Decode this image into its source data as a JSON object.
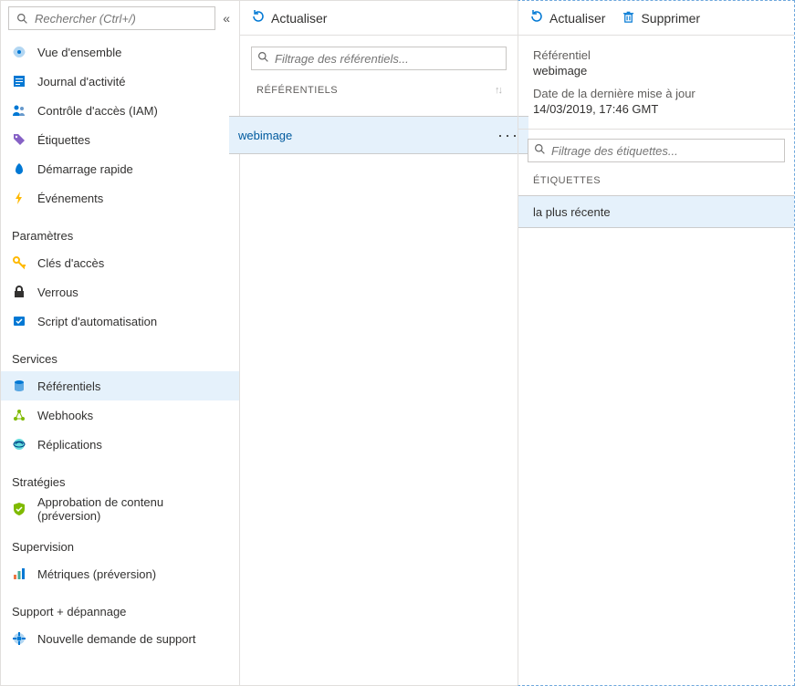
{
  "sidebar": {
    "search_placeholder": "Rechercher (Ctrl+/)",
    "items_top": [
      {
        "label": "Vue d'ensemble",
        "icon": "overview-icon",
        "color": "#0078d4"
      },
      {
        "label": "Journal d'activité",
        "icon": "activity-log-icon",
        "color": "#0078d4"
      },
      {
        "label": "Contrôle d'accès (IAM)",
        "icon": "iam-icon",
        "color": "#0078d4"
      },
      {
        "label": "Étiquettes",
        "icon": "tags-icon",
        "color": "#8661c5"
      },
      {
        "label": "Démarrage rapide",
        "icon": "quickstart-icon",
        "color": "#0078d4"
      },
      {
        "label": "Événements",
        "icon": "events-icon",
        "color": "#ffb900"
      }
    ],
    "sections": [
      {
        "title": "Paramètres",
        "items": [
          {
            "label": "Clés d'accès",
            "icon": "keys-icon",
            "color": "#ffb900"
          },
          {
            "label": "Verrous",
            "icon": "locks-icon",
            "color": "#323130"
          },
          {
            "label": "Script d'automatisation",
            "icon": "automation-icon",
            "color": "#0078d4"
          }
        ]
      },
      {
        "title": "Services",
        "items": [
          {
            "label": "Référentiels",
            "icon": "repositories-icon",
            "color": "#0078d4",
            "selected": true
          },
          {
            "label": "Webhooks",
            "icon": "webhooks-icon",
            "color": "#7fba00"
          },
          {
            "label": "Réplications",
            "icon": "replications-icon",
            "color": "#0078d4"
          }
        ]
      },
      {
        "title": "Stratégies",
        "items": [
          {
            "label": "Approbation de contenu (préversion)",
            "icon": "shield-icon",
            "color": "#7fba00"
          }
        ]
      },
      {
        "title": "Supervision",
        "items": [
          {
            "label": "Métriques (préversion)",
            "icon": "metrics-icon",
            "color": "#0078d4"
          }
        ]
      },
      {
        "title": "Support + dépannage",
        "items": [
          {
            "label": "Nouvelle demande de support",
            "icon": "support-icon",
            "color": "#0078d4"
          }
        ]
      }
    ]
  },
  "middle": {
    "refresh_label": "Actualiser",
    "filter_placeholder": "Filtrage des référentiels...",
    "column_header": "RÉFÉRENTIELS",
    "repo_name": "webimage"
  },
  "right": {
    "refresh_label": "Actualiser",
    "delete_label": "Supprimer",
    "repo_label": "Référentiel",
    "repo_value": "webimage",
    "updated_label": "Date de la dernière mise à jour",
    "updated_value": "14/03/2019, 17:46 GMT",
    "filter_placeholder": "Filtrage des étiquettes...",
    "tags_header": "ÉTIQUETTES",
    "tag_value": "la plus récente"
  }
}
